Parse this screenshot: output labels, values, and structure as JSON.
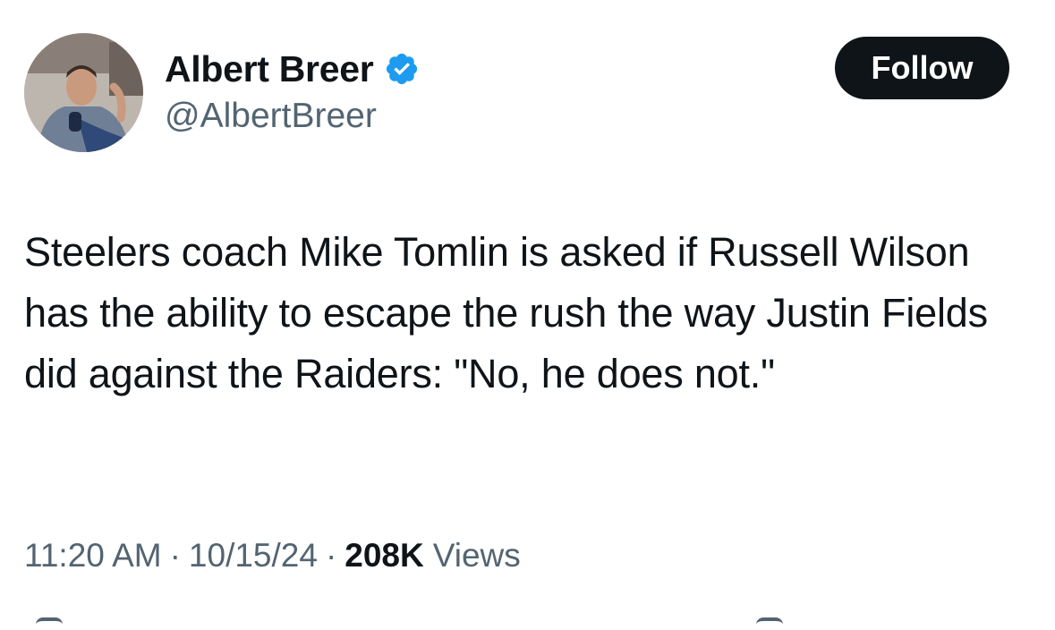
{
  "author": {
    "name": "Albert Breer",
    "handle": "@AlbertBreer",
    "verified": true,
    "verified_color": "#1d9bf0"
  },
  "follow_button": {
    "label": "Follow",
    "bg_color": "#0f1419"
  },
  "tweet": {
    "text": "Steelers coach Mike Tomlin is asked if Russell Wilson has the ability to escape the rush the way Justin Fields did against the Raiders: \"No, he does not.\""
  },
  "meta": {
    "time": "11:20 AM",
    "separator": "·",
    "date": "10/15/24",
    "views_count": "208K",
    "views_label": "Views"
  },
  "icons": {
    "verified": "verified-badge-icon",
    "avatar": "profile-photo"
  }
}
